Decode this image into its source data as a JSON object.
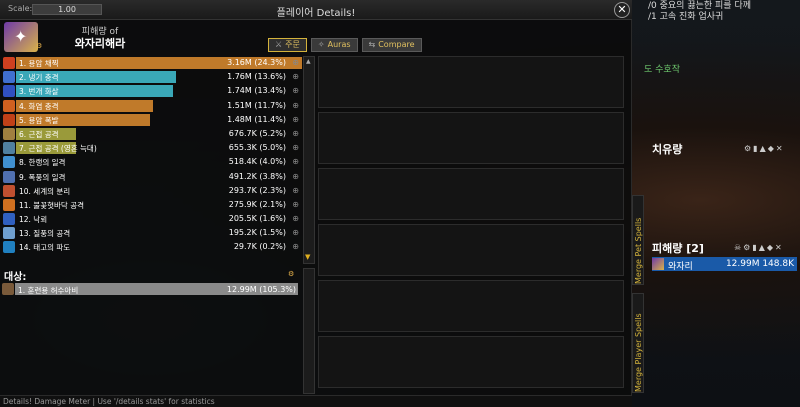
{
  "window": {
    "title": "플레이어 Details!",
    "scale_label": "Scale:",
    "scale_value": "1.00",
    "close_label": "✕"
  },
  "player": {
    "subtitle": "피해량 of",
    "name": "와자리해라",
    "class_icon": "mage-class-icon"
  },
  "tabs": [
    {
      "label": "주문",
      "icon": "sword-icon",
      "active": true
    },
    {
      "label": "Auras",
      "icon": "aura-icon",
      "active": false
    },
    {
      "label": "Compare",
      "icon": "compare-icon",
      "active": false
    }
  ],
  "spells": [
    {
      "name": "1. 용암 채찍",
      "value": "3.16M (24.3%)",
      "pct": 100,
      "bar": "#c07a2a",
      "icon": "#d04020"
    },
    {
      "name": "2. 냉기 충격",
      "value": "1.76M (13.6%)",
      "pct": 56,
      "bar": "#3aa8b8",
      "icon": "#4070d0"
    },
    {
      "name": "3. 번개 화살",
      "value": "1.74M (13.4%)",
      "pct": 55,
      "bar": "#3aa8b8",
      "icon": "#3050c0"
    },
    {
      "name": "4. 화염 충격",
      "value": "1.51M (11.7%)",
      "pct": 48,
      "bar": "#c07a2a",
      "icon": "#d06020"
    },
    {
      "name": "5. 용암 폭발",
      "value": "1.48M (11.4%)",
      "pct": 47,
      "bar": "#c07a2a",
      "icon": "#c04018"
    },
    {
      "name": "6. 근접 공격",
      "value": "676.7K (5.2%)",
      "pct": 21,
      "bar": "#9a9a3a",
      "icon": "#a08040"
    },
    {
      "name": "7. 근접 공격 (영혼 늑대)",
      "value": "655.3K (5.0%)",
      "pct": 21,
      "bar": "#9a9a3a",
      "icon": "#5080a0"
    },
    {
      "name": "8. 한랭의 일격",
      "value": "518.4K (4.0%)",
      "pct": 0,
      "bar": "#3aa8b8",
      "icon": "#4090d0"
    },
    {
      "name": "9. 폭풍의 일격",
      "value": "491.2K (3.8%)",
      "pct": 0,
      "bar": "#3aa8b8",
      "icon": "#5070b0"
    },
    {
      "name": "10. 세계의 분리",
      "value": "293.7K (2.3%)",
      "pct": 0,
      "bar": "#c07a2a",
      "icon": "#c05030"
    },
    {
      "name": "11. 불꽃혓바닥 공격",
      "value": "275.9K (2.1%)",
      "pct": 0,
      "bar": "#c07a2a",
      "icon": "#d07020"
    },
    {
      "name": "12. 낙뢰",
      "value": "205.5K (1.6%)",
      "pct": 0,
      "bar": "#3aa8b8",
      "icon": "#3060c0"
    },
    {
      "name": "13. 질풍의 공격",
      "value": "195.2K (1.5%)",
      "pct": 0,
      "bar": "#3aa8b8",
      "icon": "#70a0d0"
    },
    {
      "name": "14. 태고의 파도",
      "value": "29.7K (0.2%)",
      "pct": 0,
      "bar": "#3aa8b8",
      "icon": "#2080c0"
    }
  ],
  "targets": {
    "label": "대상:",
    "items": [
      {
        "name": "1. 훈련용 허수아비",
        "value": "12.99M (105.3%)"
      }
    ]
  },
  "status_bar": "Details! Damage Meter | Use '/details stats' for statistics",
  "side_tabs": {
    "merge_pet": "Merge Pet Spells",
    "merge_player": "Merge Player Spells"
  },
  "right_ui": {
    "top_line1": "/0 중요의 끓는한 피를 다께",
    "top_line2": "/1 고속 진화 업사귀",
    "green_text": "도 수호작",
    "healing_title": "치유량",
    "damage_title": "피해량 [2]",
    "meter_row": {
      "name": "와자리",
      "value": "12.99M 148.8K"
    }
  }
}
